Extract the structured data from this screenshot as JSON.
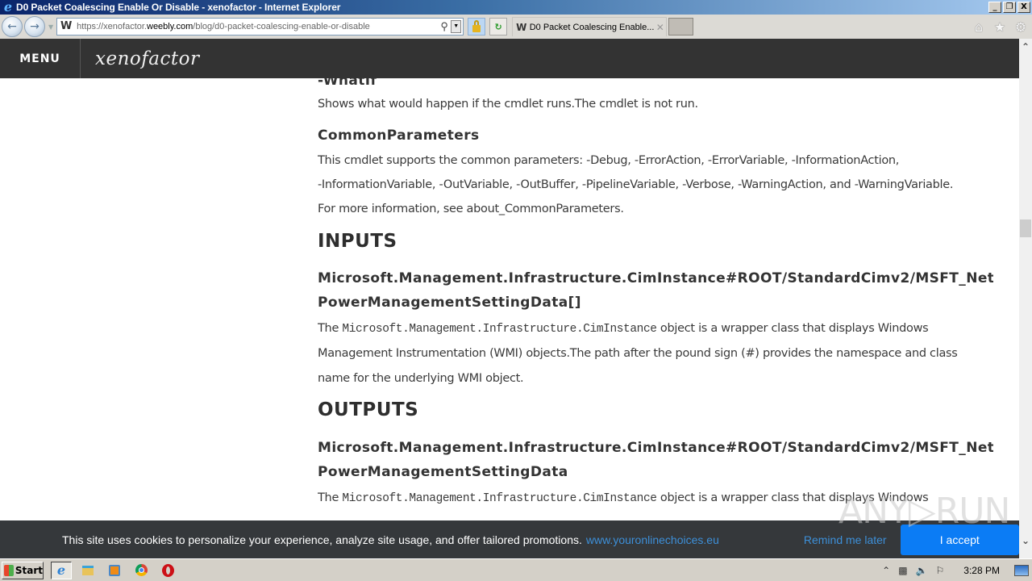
{
  "window": {
    "title": "D0 Packet Coalescing Enable Or Disable - xenofactor - Internet Explorer",
    "minimize": "_",
    "restore": "❐",
    "close": "X"
  },
  "browser": {
    "url_prefix": "https://xenofactor.",
    "url_host": "weebly.com",
    "url_path": "/blog/d0-packet-coalescing-enable-or-disable",
    "tab_title": "D0 Packet Coalescing Enable...",
    "icons": {
      "back": "back-icon",
      "forward": "forward-icon",
      "search": "search-icon",
      "lock": "lock-icon",
      "refresh": "compat-refresh-icon",
      "home": "home-icon",
      "favorites": "star-icon",
      "tools": "gear-icon"
    }
  },
  "site": {
    "menu_label": "MENU",
    "title": "xenofactor"
  },
  "content": {
    "whatif_heading": "-WhatIf",
    "whatif_desc": "Shows what would happen if the cmdlet runs.The cmdlet is not run.",
    "common_heading": "CommonParameters",
    "common_lines": [
      "This cmdlet supports the common parameters: -Debug, -ErrorAction, -ErrorVariable, -InformationAction,",
      "-InformationVariable, -OutVariable, -OutBuffer, -PipelineVariable, -Verbose, -WarningAction, and -WarningVariable.",
      "For more information, see about_CommonParameters."
    ],
    "inputs_heading": "INPUTS",
    "inputs_type_line1": "Microsoft.Management.Infrastructure.CimInstance#ROOT/StandardCimv2/MSFT_NetAdapterPowerManagementSettingData[]",
    "inputs_type_line2": "PowerManagementSettingData[]",
    "inputs_desc_pre": "The ",
    "inputs_desc_code": "Microsoft.Management.Infrastructure.CimInstance",
    "inputs_desc_post": " object is a wrapper class that displays Windows",
    "inputs_desc_line2": "Management Instrumentation (WMI) objects.The path after the pound sign (#) provides the namespace and class",
    "inputs_desc_line3": "name for the underlying WMI object.",
    "outputs_heading": "OUTPUTS",
    "outputs_type_line1": "Microsoft.Management.Infrastructure.CimInstance#ROOT/StandardCimv2/MSFT_NetAdapterPowerManagementSettingData",
    "outputs_type_line2": "PowerManagementSettingData",
    "outputs_desc_pre": "The ",
    "outputs_desc_code": "Microsoft.Management.Infrastructure.CimInstance",
    "outputs_desc_post": " object is a wrapper class that displays Windows"
  },
  "scrollbar": {
    "up": "⌃",
    "down": "⌄",
    "position_fraction": 0.35
  },
  "cookie_banner": {
    "message": "This site uses cookies to personalize your experience, analyze site usage, and offer tailored promotions.",
    "link": "www.youronlinechoices.eu",
    "remind": "Remind me later",
    "accept": "I accept"
  },
  "watermark": "ANY▷RUN",
  "taskbar": {
    "start_label": "Start",
    "apps": [
      "internet-explorer",
      "file-explorer",
      "media-player",
      "chrome",
      "opera"
    ],
    "clock": "3:28 PM"
  },
  "colors": {
    "header_bg": "#333333",
    "cookie_bg": "#35383b",
    "accent_blue": "#0b7cf5",
    "link_blue": "#3d8fd8"
  }
}
